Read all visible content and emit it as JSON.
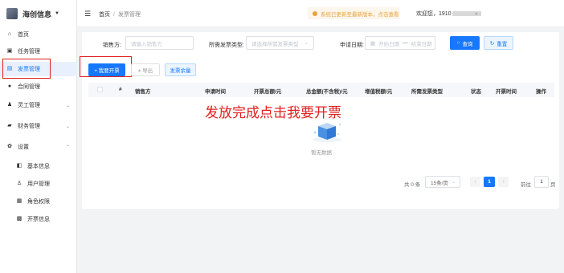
{
  "app": {
    "logo_text": "海创信息"
  },
  "sidebar": {
    "items": [
      {
        "label": "首页",
        "icon": "home-icon"
      },
      {
        "label": "任务管理",
        "icon": "task-icon"
      },
      {
        "label": "发票管理",
        "icon": "invoice-icon",
        "active": true
      },
      {
        "label": "合同管理",
        "icon": "contract-icon"
      },
      {
        "label": "灵工管理",
        "icon": "worker-icon"
      },
      {
        "label": "财务管理",
        "icon": "finance-icon"
      },
      {
        "label": "设置",
        "icon": "settings-icon"
      }
    ],
    "sub_items": [
      {
        "label": "基本信息",
        "icon": "info-icon"
      },
      {
        "label": "用户管理",
        "icon": "user-icon"
      },
      {
        "label": "角色权限",
        "icon": "role-icon"
      },
      {
        "label": "开票信息",
        "icon": "billing-icon"
      }
    ]
  },
  "header": {
    "breadcrumb": [
      "首页",
      "发票管理"
    ],
    "notice": "系统已更新至最新版本，点击查看",
    "welcome": "欢迎您，1910"
  },
  "filters": {
    "seller_label": "销售方:",
    "seller_placeholder": "请输入销售方",
    "type_label": "所需发票类型:",
    "type_placeholder": "请选择所需发票类型",
    "date_label": "申请日期:",
    "date_start": "开始日期",
    "date_sep": "—",
    "date_end": "结束日期",
    "search": "查询",
    "reset": "重置"
  },
  "toolbar": {
    "issue_invoice": "+ 我要开票",
    "export": "± 导出",
    "invoice_balance": "发票余量"
  },
  "table": {
    "columns": [
      "#",
      "销售方",
      "申请时间",
      "开票总额/元",
      "总金额(不含税)/元",
      "增值税额/元",
      "所需发票类型",
      "状态",
      "开票时间",
      "操作"
    ],
    "empty_text": "暂无数据"
  },
  "annotation": "发放完成点击我要开票",
  "pagination": {
    "total": "共 0 条",
    "page_size": "15条/页",
    "current_page": "1",
    "goto_label": "前往",
    "goto_value": "1",
    "goto_unit": "页"
  },
  "colors": {
    "primary": "#1677ff",
    "annotation_red": "#e02020",
    "notice_orange": "#e6a23c"
  }
}
